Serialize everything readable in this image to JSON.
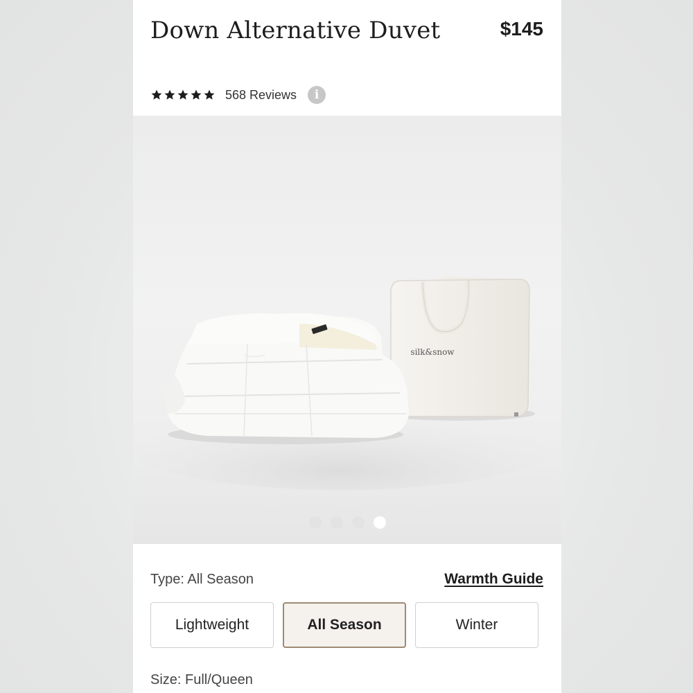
{
  "product": {
    "title": "Down Alternative Duvet",
    "price": "$145",
    "rating": 5,
    "reviews_label": "568 Reviews",
    "info_icon": "info-icon"
  },
  "gallery": {
    "brand_on_bag": "silk&snow",
    "slide_count": 4,
    "active_slide": 4
  },
  "type_selector": {
    "label": "Type: All Season",
    "guide_link": "Warmth Guide",
    "options": [
      "Lightweight",
      "All Season",
      "Winter"
    ],
    "selected": "All Season",
    "selected_border_color": "#9c8a74"
  },
  "size_selector": {
    "label": "Size: Full/Queen"
  }
}
